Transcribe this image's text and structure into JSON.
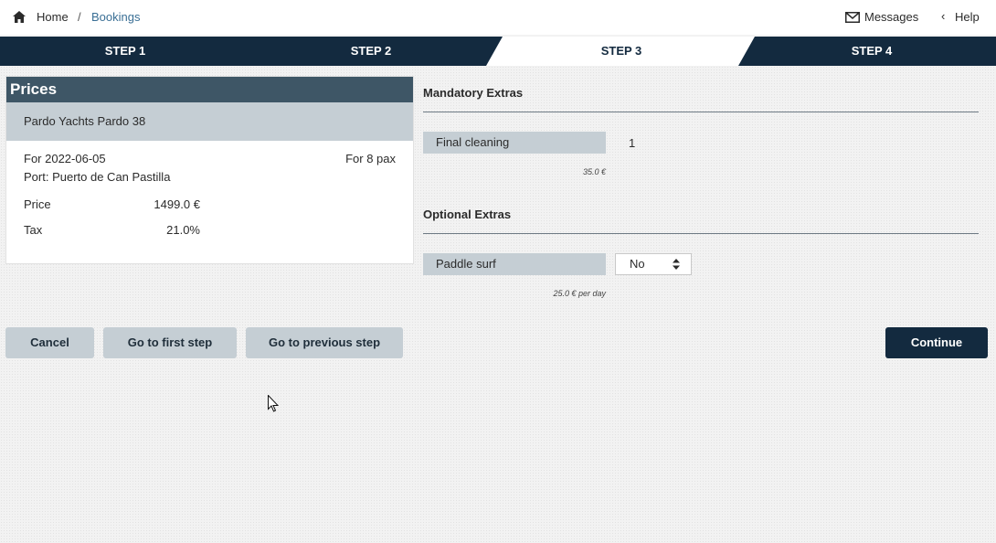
{
  "breadcrumb": {
    "home": "Home",
    "separator": "/",
    "current": "Bookings",
    "home_icon": "home-icon"
  },
  "header": {
    "messages": "Messages",
    "help_chevron": "‹",
    "help": "Help",
    "messages_icon": "mail-icon"
  },
  "steps": [
    "STEP 1",
    "STEP 2",
    "STEP 3",
    "STEP 4"
  ],
  "active_step": 3,
  "prices": {
    "title": "Prices",
    "boat": "Pardo Yachts Pardo 38",
    "date": "For 2022-06-05",
    "pax": "For 8 pax",
    "port": "Port: Puerto de Can Pastilla",
    "price_label": "Price",
    "price_value": "1499.0 €",
    "tax_label": "Tax",
    "tax_value": "21.0%"
  },
  "mandatory": {
    "title": "Mandatory Extras",
    "items": [
      {
        "label": "Final cleaning",
        "qty": "1",
        "price": "35.0 €"
      }
    ]
  },
  "optional": {
    "title": "Optional Extras",
    "items": [
      {
        "label": "Paddle surf",
        "selected": "No",
        "price": "25.0 € per day"
      }
    ]
  },
  "buttons": {
    "cancel": "Cancel",
    "first": "Go to first step",
    "previous": "Go to previous step",
    "continue": "Continue"
  },
  "colors": {
    "navy": "#132a3f",
    "slate": "#3e5666",
    "band": "#c5ced4",
    "link": "#3a6f95"
  }
}
